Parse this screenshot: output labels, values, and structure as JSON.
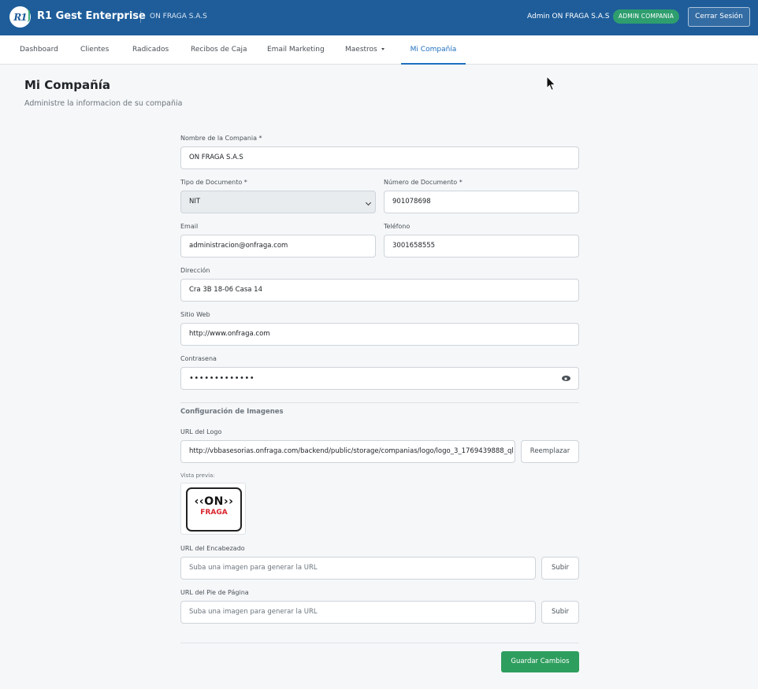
{
  "header": {
    "logo_text": "R1",
    "brand": "R1 Gest Enterprise",
    "company": "ON FRAGA S.A.S",
    "user_name": "Admin ON FRAGA S.A.S",
    "role_badge": "ADMIN COMPANIA",
    "logout_label": "Cerrar Sesión",
    "colors": {
      "topbar": "#1e5d9a",
      "badge": "#2e9e6e"
    }
  },
  "nav": {
    "items": [
      "Dashboard",
      "Clientes",
      "Radicados",
      "Recibos de Caja",
      "Email Marketing",
      "Maestros",
      "Mi Compañía"
    ],
    "active_index": 6,
    "active_color": "#1e6fbf"
  },
  "page": {
    "title": "Mi Compañía",
    "subtitle": "Administre la informacion de su compañia"
  },
  "form": {
    "company_name": {
      "label": "Nombre de la Compania *",
      "value": "ON FRAGA S.A.S"
    },
    "doc_type": {
      "label": "Tipo de Documento *",
      "value": "NIT"
    },
    "doc_number": {
      "label": "Número de Documento *",
      "value": "901078698"
    },
    "email": {
      "label": "Email",
      "value": "administracion@onfraga.com"
    },
    "phone": {
      "label": "Teléfono",
      "value": "3001658555"
    },
    "address": {
      "label": "Dirección",
      "value": "Cra 3B 18-06 Casa 14"
    },
    "website": {
      "label": "Sitio Web",
      "value": "http://www.onfraga.com"
    },
    "password": {
      "label": "Contrasena",
      "value": "•••••••••••••"
    },
    "images": {
      "section_title": "Configuración de Imagenes",
      "logo_url": {
        "label": "URL del Logo",
        "value": "http://vbbasesorias.onfraga.com/backend/public/storage/companias/logo/logo_3_1769439888_ql",
        "button": "Reemplazar"
      },
      "preview_label": "Vista previa:",
      "preview_logo": {
        "top": "ON",
        "bottom": "FRAGA"
      },
      "header_url": {
        "label": "URL del Encabezado",
        "placeholder": "Suba una imagen para generar la URL",
        "button": "Subir"
      },
      "footer_url": {
        "label": "URL del Pie de Página",
        "placeholder": "Suba una imagen para generar la URL",
        "button": "Subir"
      }
    },
    "save_label": "Guardar Cambios",
    "save_color": "#2e9e5e"
  }
}
